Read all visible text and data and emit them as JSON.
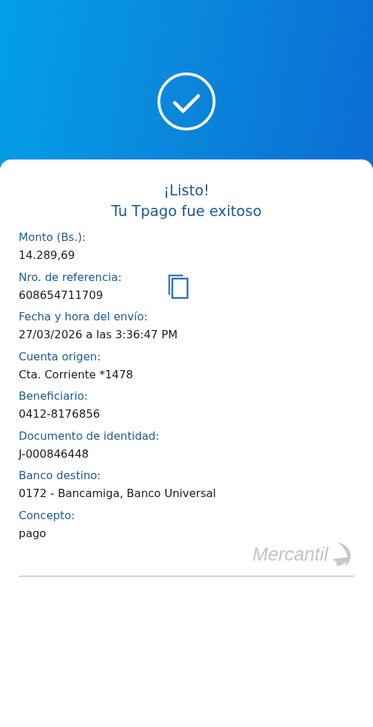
{
  "title": [
    "¡Listo!",
    "Tu Tpago fue exitoso"
  ],
  "fields": [
    {
      "label": "Monto (Bs.):",
      "value": "14.289,69",
      "copyable": false
    },
    {
      "label": "Nro. de referencia:",
      "value": "608654711709",
      "copyable": true
    },
    {
      "label": "Fecha y hora del envío:",
      "value": "27/03/2026 a las 3:36:47 PM",
      "copyable": false
    },
    {
      "label": "Cuenta origen:",
      "value": "Cta. Corriente *1478",
      "copyable": false
    },
    {
      "label": "Beneficiario:",
      "value": "0412-8176856",
      "copyable": false
    },
    {
      "label": "Documento de identidad:",
      "value": "J-000846448",
      "copyable": false
    },
    {
      "label": "Banco destino:",
      "value": "0172 - Bancamiga, Banco Universal",
      "copyable": false
    },
    {
      "label": "Concepto:",
      "value": "pago",
      "copyable": false
    }
  ],
  "logo": "Mercantil"
}
